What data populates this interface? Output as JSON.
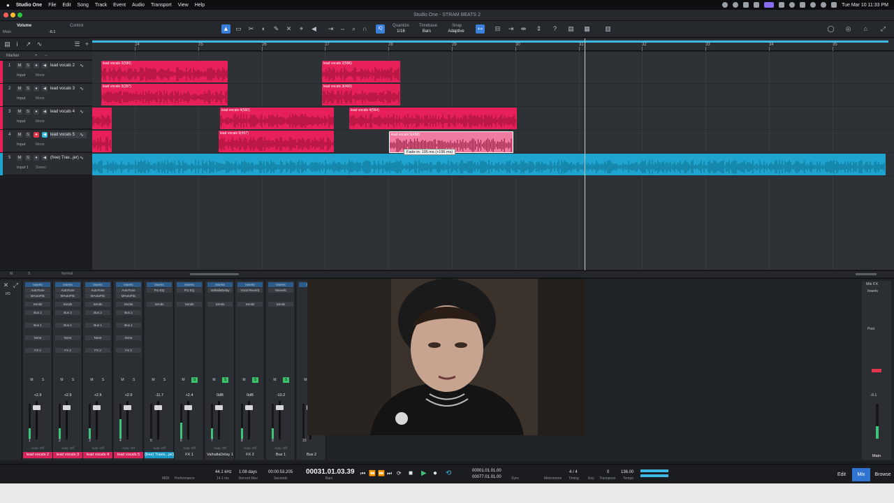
{
  "menubar": {
    "apple": "",
    "app_name": "Studio One",
    "menus": [
      "File",
      "Edit",
      "Song",
      "Track",
      "Event",
      "Audio",
      "Transport",
      "View",
      "Help"
    ],
    "clock": "Tue Mar 10  11:33 PM"
  },
  "window": {
    "title": "Studio One - STRAM BEATS 2"
  },
  "toolbar": {
    "param_label": "Volume",
    "param_scope": "Main",
    "control_label": "Control",
    "param_value": "-6.1",
    "quantize_label": "Quantize",
    "quantize_value": "1/16",
    "timebase_label": "Timebase",
    "timebase_value": "Bars",
    "snap_label": "Snap",
    "snap_value": "Adaptive",
    "iq_label": "IQ"
  },
  "ruler": {
    "bars": [
      "24",
      "25",
      "26",
      "27",
      "28",
      "29",
      "30",
      "31",
      "32",
      "33",
      "34",
      "35"
    ]
  },
  "marker_label": "Marker",
  "tracks": [
    {
      "num": "1",
      "name": "lead vocals 2",
      "input": "Input",
      "mode": "Mono",
      "color": "#e8205a"
    },
    {
      "num": "2",
      "name": "lead vocals 3",
      "input": "Input",
      "mode": "Mono",
      "color": "#e8205a"
    },
    {
      "num": "3",
      "name": "lead vocals 4",
      "input": "Input",
      "mode": "Mono",
      "color": "#e8205a"
    },
    {
      "num": "4",
      "name": "lead vocals 5",
      "input": "Input",
      "mode": "Mono",
      "color": "#e8205a"
    },
    {
      "num": "5",
      "name": "(free) Trav...jer)",
      "input": "Input 1",
      "mode": "Stereo",
      "color": "#1fa3cf"
    }
  ],
  "clips": [
    {
      "label": "lead vocals 2(590)"
    },
    {
      "label": "lead vocals 2(596)"
    },
    {
      "label": "lead vocals 3(397)"
    },
    {
      "label": "lead vocals 3(400)"
    },
    {
      "label": "lead vocals 4(560)"
    },
    {
      "label": "lead vocals 4(564)"
    },
    {
      "label": "lead vocals 5(457)"
    },
    {
      "label": "lead vocals 5(458)"
    },
    {
      "label": ""
    }
  ],
  "tooltip": "Fade-in: 195 ms (+195 ms)",
  "arrange_footer": {
    "m": "M",
    "s": "S",
    "mode": "Normal"
  },
  "mixer": {
    "strips": [
      {
        "vol": "+2.9",
        "num": "1",
        "name": "lead vocals 2",
        "name_style": "pink",
        "ins": [
          "Inserts",
          "AutoTune",
          "MAutoPitc"
        ],
        "sends": "Sends",
        "bus": "Bus 2",
        "bus2": "Bus 1",
        "none": "None",
        "fx": "FX 2",
        "mode": "Auto: Off",
        "level": 0.3
      },
      {
        "vol": "+2.9",
        "num": "2",
        "name": "lead vocals 3",
        "name_style": "pink",
        "ins": [
          "Inserts",
          "AutoTune",
          "MAutoPitc"
        ],
        "sends": "Sends",
        "bus": "Bus 2",
        "bus2": "Bus 1",
        "none": "None",
        "fx": "FX 2",
        "mode": "Auto: Off",
        "level": 0.3
      },
      {
        "vol": "+2.9",
        "num": "3",
        "name": "lead vocals 4",
        "name_style": "pink",
        "ins": [
          "Inserts",
          "AutoTune",
          "MAutoPitc"
        ],
        "sends": "Sends",
        "bus": "Bus 2",
        "bus2": "Bus 1",
        "none": "None",
        "fx": "FX 2",
        "mode": "Auto: Off",
        "level": 0.3
      },
      {
        "vol": "+2.9",
        "num": "4",
        "name": "lead vocals 5",
        "name_style": "pink",
        "ins": [
          "Inserts",
          "AutoTune",
          "MAutoPitc"
        ],
        "sends": "Sends",
        "bus": "Bus 2",
        "bus2": "Bus 1",
        "none": "None",
        "fx": "FX 2",
        "mode": "Auto: Off",
        "level": 0.55
      },
      {
        "vol": "-11.7",
        "num": "5",
        "name": "(free) Travis...pe)",
        "name_style": "blue",
        "ins": [
          "Inserts",
          "Pro EQ",
          ""
        ],
        "sends": "Sends",
        "bus": "",
        "bus2": "",
        "none": "",
        "fx": "",
        "mode": "Auto: Off",
        "level": 0.0
      },
      {
        "vol": "+2.4",
        "num": "6",
        "name": "FX 1",
        "name_style": "dark",
        "ins": [
          "Inserts",
          "Pro EQ",
          ""
        ],
        "sends": "Sends",
        "bus": "",
        "bus2": "",
        "none": "",
        "fx": "",
        "mode": "Auto: Off",
        "level": 0.45
      },
      {
        "vol": "0dB",
        "num": "7",
        "name": "ValhallaDelay 1",
        "name_style": "dark",
        "ins": [
          "Inserts",
          "ValhallaDelay",
          ""
        ],
        "sends": "Sends",
        "bus": "",
        "bus2": "",
        "none": "",
        "fx": "",
        "mode": "Auto: Off",
        "level": 0.3
      },
      {
        "vol": "0dB",
        "num": "8",
        "name": "FX 2",
        "name_style": "dark",
        "ins": [
          "Inserts",
          "Vocal Reverb",
          ""
        ],
        "sends": "Sends",
        "bus": "",
        "bus2": "",
        "none": "",
        "fx": "",
        "mode": "Auto: Off",
        "level": 0.3
      },
      {
        "vol": "-10.2",
        "num": "9",
        "name": "Bus 1",
        "name_style": "dark",
        "ins": [
          "Inserts",
          "Mixverb",
          ""
        ],
        "sends": "Sends",
        "bus": "",
        "bus2": "",
        "none": "",
        "fx": "",
        "mode": "Auto: Off",
        "level": 0.3
      },
      {
        "vol": "",
        "num": "10",
        "name": "Bus 2",
        "name_style": "dark",
        "ins": [
          "Mix FX",
          "",
          ""
        ],
        "sends": "",
        "bus": "",
        "bus2": "",
        "none": "",
        "fx": "",
        "mode": "",
        "level": 0.0
      }
    ],
    "main": {
      "label": "Mix FX",
      "inserts": "Inserts",
      "post": "Post",
      "vol": "-0.1",
      "name": "Main",
      "level": 0.35
    }
  },
  "transport": {
    "midi": "MIDI",
    "performance": "Performance",
    "samplerate": "44.1 kHz",
    "latency": "14.1 ms",
    "record_days": "1:08 days",
    "record_max": "Record Max",
    "seconds_time": "00:00:53.205",
    "seconds_label": "Seconds",
    "bars_time": "00031.01.03.39",
    "bars_label": "Bars",
    "loop_start": "00001.01.01.00",
    "loop_end": "00077.01.01.00",
    "sync": "Sync",
    "signature": "4 / 4",
    "metronome": "Metronome",
    "timing": "Timing",
    "key": "Key",
    "transpose_value": "0",
    "transpose": "Transpose",
    "tempo_value": "136.00",
    "tempo": "Tempo",
    "edit": "Edit",
    "mix": "Mix",
    "browse": "Browse"
  },
  "colors": {
    "vocal": "#e8205a",
    "beat": "#1fa3cf",
    "accent": "#2f74d0"
  }
}
